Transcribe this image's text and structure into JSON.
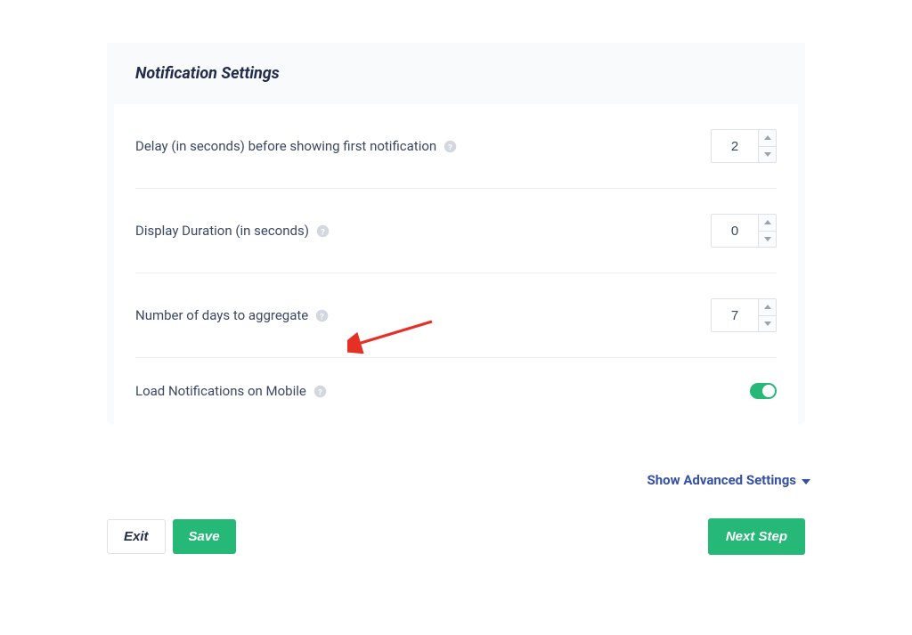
{
  "panel": {
    "title": "Notification Settings"
  },
  "settings": {
    "delay": {
      "label": "Delay (in seconds) before showing first notification",
      "value": "2"
    },
    "duration": {
      "label": "Display Duration (in seconds)",
      "value": "0"
    },
    "aggregate": {
      "label": "Number of days to aggregate",
      "value": "7"
    },
    "mobile": {
      "label": "Load Notifications on Mobile"
    }
  },
  "advanced": {
    "label": "Show Advanced Settings"
  },
  "buttons": {
    "exit": "Exit",
    "save": "Save",
    "next": "Next Step"
  }
}
